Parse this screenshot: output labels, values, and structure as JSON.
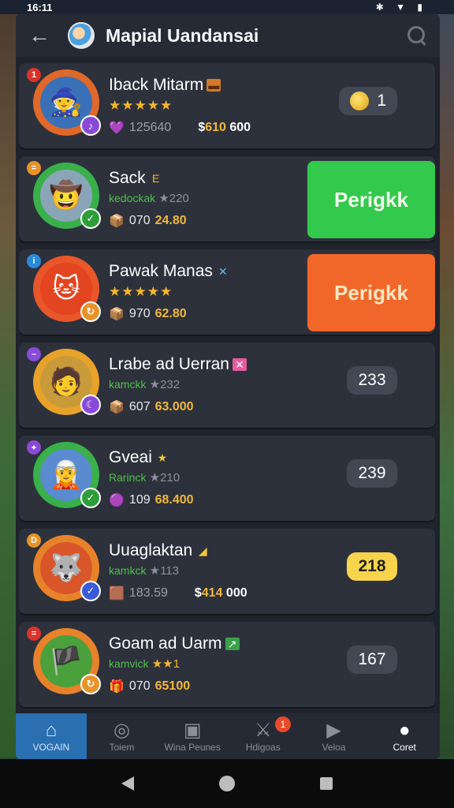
{
  "status": {
    "time": "16:11",
    "icons": "✱ ▼ ▮"
  },
  "header": {
    "title": "Mapial Uandansai"
  },
  "rows": [
    {
      "rank": "1",
      "name": "Iback Mitarm",
      "tag": "▬",
      "sub": "★★★★★",
      "sub_type": "stars",
      "line3_num": "125640",
      "line3_money_prefix": "$",
      "line3_money_gold": "610",
      "line3_money_rest": "600",
      "right_type": "pill",
      "right_value": "1",
      "has_coin": true
    },
    {
      "rank": "=",
      "name": "Sack",
      "tag": "E",
      "sub_handle": "kedockak",
      "sub_rating": "★220",
      "sub_type": "handle",
      "line3_num": "070",
      "line3_gold": "24.80",
      "right_type": "green",
      "right_value": "Perigkk"
    },
    {
      "rank": "i",
      "name": "Pawak Manas",
      "tag": "✕",
      "sub": "★★★★★",
      "sub_type": "stars",
      "line3_num": "970",
      "line3_gold": "62.80",
      "right_type": "orange",
      "right_value": "Perigkk"
    },
    {
      "rank": "–",
      "name": "Lrabe ad Uerran",
      "tag": "✕",
      "sub_handle": "kamckk",
      "sub_rating": "★232",
      "sub_type": "handle",
      "line3_num": "607",
      "line3_gold": "63.000",
      "right_type": "pill",
      "right_value": "233"
    },
    {
      "rank": "✦",
      "name": "Gveai",
      "tag": "★",
      "sub_handle": "Rarinck",
      "sub_rating": "★210",
      "sub_type": "handle",
      "line3_num": "109",
      "line3_gold": "68.400",
      "right_type": "pill",
      "right_value": "239"
    },
    {
      "rank": "D",
      "name": "Uuaglaktan",
      "tag": "◢",
      "sub_handle": "kamkck",
      "sub_rating": "★113",
      "sub_type": "handle",
      "line3_num": "183.59",
      "line3_money_prefix": "$",
      "line3_money_gold": "414",
      "line3_money_rest": "000",
      "right_type": "yellow",
      "right_value": "218"
    },
    {
      "rank": "=",
      "name": "Goam ad Uarm",
      "tag": "↗",
      "sub_handle": "kamvick",
      "sub_rating": "★★1",
      "sub_type": "handle",
      "line3_num": "070",
      "line3_gold": "65100",
      "right_type": "pill",
      "right_value": "167"
    }
  ],
  "tabs": [
    {
      "label": "VOGAIN",
      "icon": "home-icon"
    },
    {
      "label": "Toiem",
      "icon": "globe-icon"
    },
    {
      "label": "Wina Peunes",
      "icon": "puzzle-icon"
    },
    {
      "label": "Hdigoas",
      "icon": "swords-icon",
      "badge": "1"
    },
    {
      "label": "Veloa",
      "icon": "video-icon"
    },
    {
      "label": "Coret",
      "icon": "profile-icon"
    }
  ],
  "colors": {
    "accent": "#2a6fb0",
    "green": "#33c94d",
    "orange": "#f1672a",
    "gold": "#f2b83a"
  }
}
